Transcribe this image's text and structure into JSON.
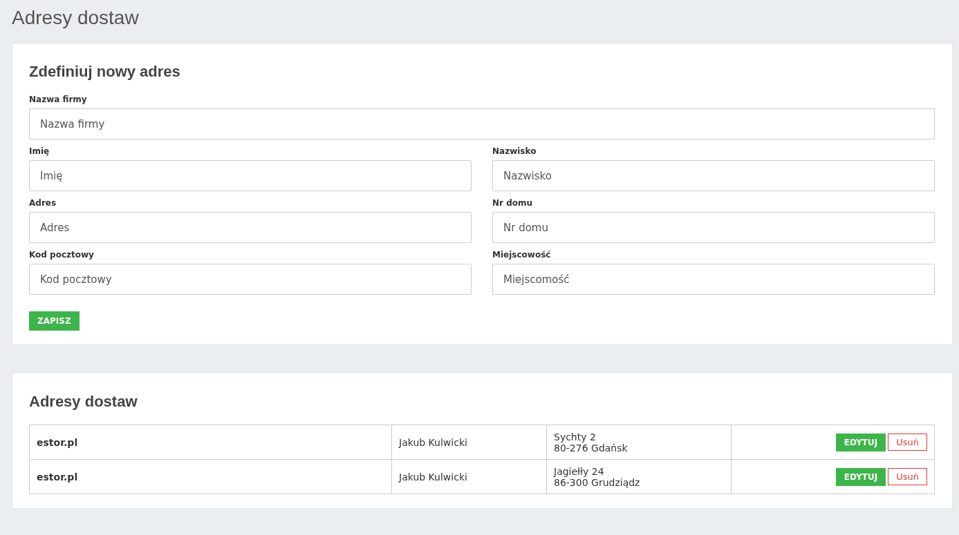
{
  "page_title": "Adresy dostaw",
  "form": {
    "title": "Zdefiniuj nowy adres",
    "rows": [
      [
        {
          "label": "Nazwa firmy",
          "placeholder": "Nazwa firmy"
        }
      ],
      [
        {
          "label": "Imię",
          "placeholder": "Imię"
        },
        {
          "label": "Nazwisko",
          "placeholder": "Nazwisko"
        }
      ],
      [
        {
          "label": "Adres",
          "placeholder": "Adres"
        },
        {
          "label": "Nr domu",
          "placeholder": "Nr domu"
        }
      ],
      [
        {
          "label": "Kod pocztowy",
          "placeholder": "Kod pocztowy"
        },
        {
          "label": "Miejscowość",
          "placeholder": "Miejscomość"
        }
      ]
    ],
    "submit": "ZAPISZ"
  },
  "addresses": {
    "title": "Adresy dostaw",
    "rows": [
      {
        "company": "estor.pl",
        "name": "Jakub Kulwicki",
        "address_lines": [
          "Sychty 2",
          "80-276 Gdańsk"
        ],
        "edit": "EDYTUJ",
        "delete": "Usuń"
      },
      {
        "company": "estor.pl",
        "name": "Jakub Kulwicki",
        "address_lines": [
          "Jagiełły 24",
          "86-300 Grudziądz"
        ],
        "edit": "EDYTUJ",
        "delete": "Usuń"
      }
    ]
  }
}
